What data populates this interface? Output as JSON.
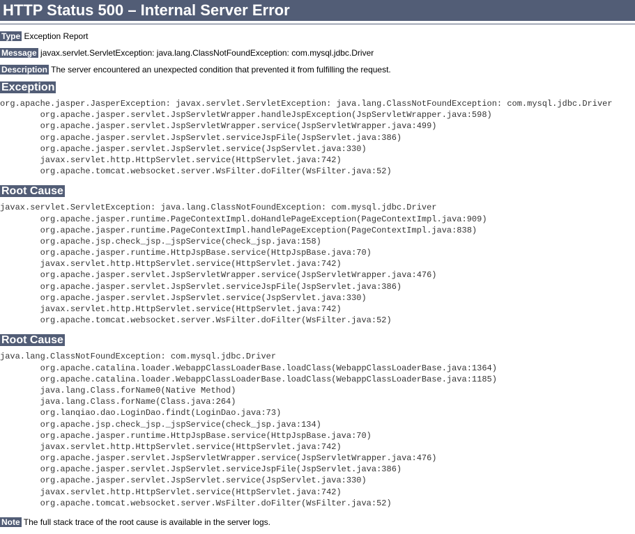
{
  "header": "HTTP Status 500 – Internal Server Error",
  "labels": {
    "type": "Type",
    "message": "Message",
    "description": "Description",
    "exception": "Exception",
    "rootCause": "Root Cause",
    "note": "Note"
  },
  "type": "Exception Report",
  "message": "javax.servlet.ServletException: java.lang.ClassNotFoundException: com.mysql.jdbc.Driver",
  "description": "The server encountered an unexpected condition that prevented it from fulfilling the request.",
  "exception_trace": "org.apache.jasper.JasperException: javax.servlet.ServletException: java.lang.ClassNotFoundException: com.mysql.jdbc.Driver\n        org.apache.jasper.servlet.JspServletWrapper.handleJspException(JspServletWrapper.java:598)\n        org.apache.jasper.servlet.JspServletWrapper.service(JspServletWrapper.java:499)\n        org.apache.jasper.servlet.JspServlet.serviceJspFile(JspServlet.java:386)\n        org.apache.jasper.servlet.JspServlet.service(JspServlet.java:330)\n        javax.servlet.http.HttpServlet.service(HttpServlet.java:742)\n        org.apache.tomcat.websocket.server.WsFilter.doFilter(WsFilter.java:52)",
  "root_cause_1": "javax.servlet.ServletException: java.lang.ClassNotFoundException: com.mysql.jdbc.Driver\n        org.apache.jasper.runtime.PageContextImpl.doHandlePageException(PageContextImpl.java:909)\n        org.apache.jasper.runtime.PageContextImpl.handlePageException(PageContextImpl.java:838)\n        org.apache.jsp.check_jsp._jspService(check_jsp.java:158)\n        org.apache.jasper.runtime.HttpJspBase.service(HttpJspBase.java:70)\n        javax.servlet.http.HttpServlet.service(HttpServlet.java:742)\n        org.apache.jasper.servlet.JspServletWrapper.service(JspServletWrapper.java:476)\n        org.apache.jasper.servlet.JspServlet.serviceJspFile(JspServlet.java:386)\n        org.apache.jasper.servlet.JspServlet.service(JspServlet.java:330)\n        javax.servlet.http.HttpServlet.service(HttpServlet.java:742)\n        org.apache.tomcat.websocket.server.WsFilter.doFilter(WsFilter.java:52)",
  "root_cause_2": "java.lang.ClassNotFoundException: com.mysql.jdbc.Driver\n        org.apache.catalina.loader.WebappClassLoaderBase.loadClass(WebappClassLoaderBase.java:1364)\n        org.apache.catalina.loader.WebappClassLoaderBase.loadClass(WebappClassLoaderBase.java:1185)\n        java.lang.Class.forName0(Native Method)\n        java.lang.Class.forName(Class.java:264)\n        org.lanqiao.dao.LoginDao.findt(LoginDao.java:73)\n        org.apache.jsp.check_jsp._jspService(check_jsp.java:134)\n        org.apache.jasper.runtime.HttpJspBase.service(HttpJspBase.java:70)\n        javax.servlet.http.HttpServlet.service(HttpServlet.java:742)\n        org.apache.jasper.servlet.JspServletWrapper.service(JspServletWrapper.java:476)\n        org.apache.jasper.servlet.JspServlet.serviceJspFile(JspServlet.java:386)\n        org.apache.jasper.servlet.JspServlet.service(JspServlet.java:330)\n        javax.servlet.http.HttpServlet.service(HttpServlet.java:742)\n        org.apache.tomcat.websocket.server.WsFilter.doFilter(WsFilter.java:52)",
  "note": "The full stack trace of the root cause is available in the server logs."
}
